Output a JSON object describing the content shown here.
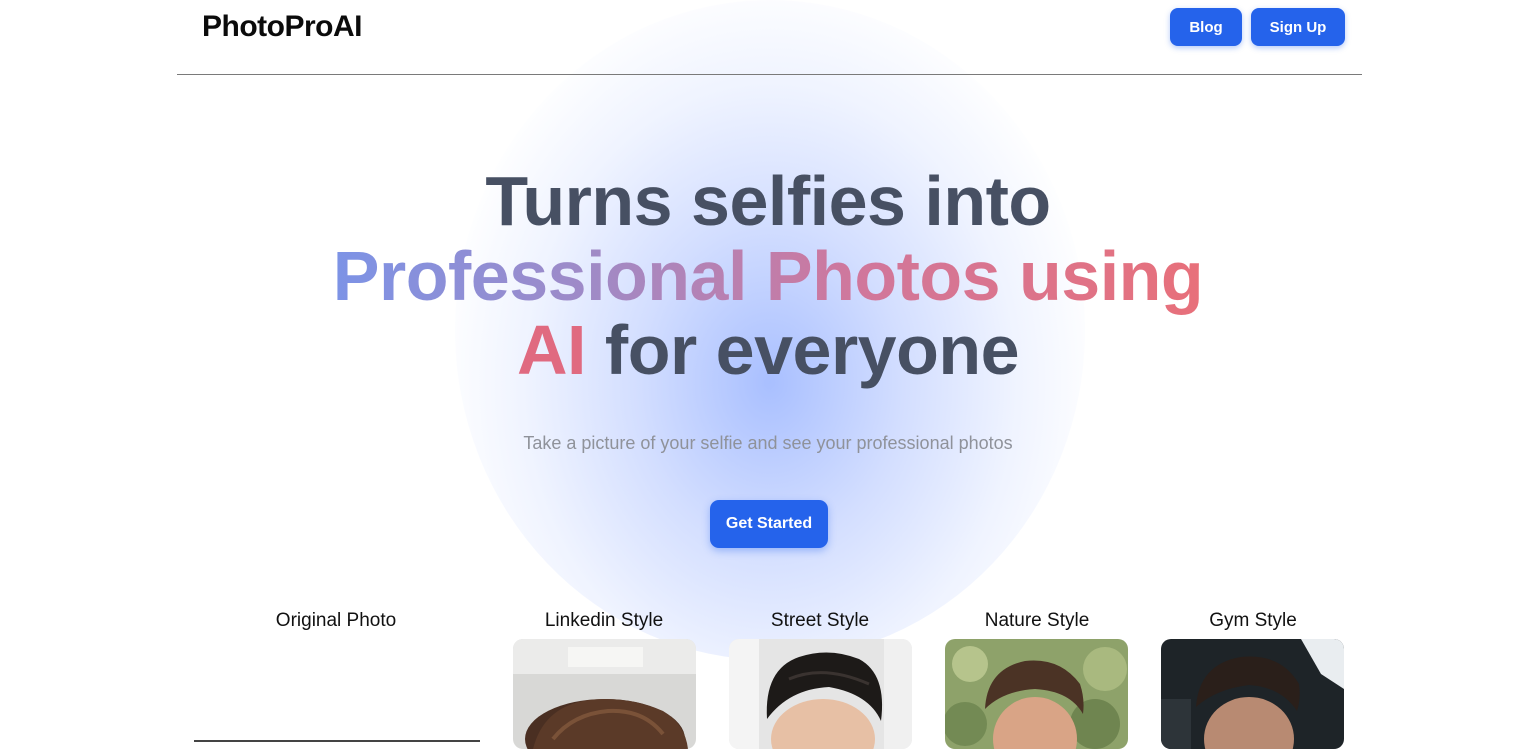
{
  "header": {
    "logo": "PhotoProAI",
    "blog_label": "Blog",
    "signup_label": "Sign Up"
  },
  "hero": {
    "line1": "Turns selfies into",
    "line2": "Professional Photos using",
    "line3_accent": "AI",
    "line3_rest": "for everyone",
    "subtitle": "Take a picture of your selfie and see your professional photos",
    "cta_label": "Get Started"
  },
  "gallery": {
    "original_label": "Original Photo",
    "styles": [
      {
        "label": "Linkedin Style"
      },
      {
        "label": "Street Style"
      },
      {
        "label": "Nature Style"
      },
      {
        "label": "Gym Style"
      }
    ]
  },
  "colors": {
    "primary": "#2563eb",
    "heading": "#475063",
    "gradient_start": "#7c93e6",
    "gradient_end": "#e8707a"
  }
}
